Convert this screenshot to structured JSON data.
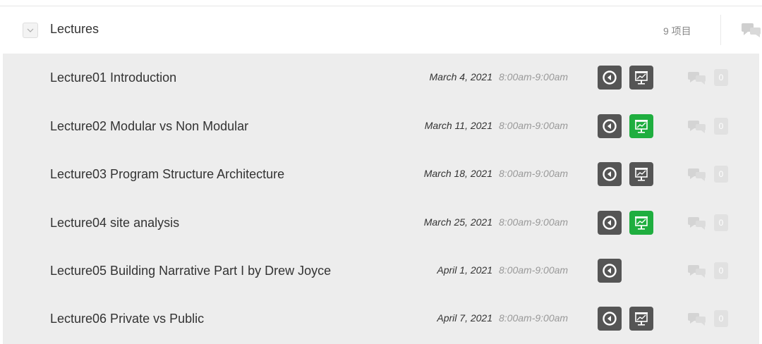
{
  "section": {
    "title": "Lectures",
    "item_count": "9 项目"
  },
  "lectures": [
    {
      "title": "Lecture01 Introduction",
      "date": "March 4, 2021",
      "time": "8:00am-9:00am",
      "has_slides": true,
      "slides_highlighted": false,
      "comment_count": "0"
    },
    {
      "title": "Lecture02 Modular vs Non Modular",
      "date": "March 11, 2021",
      "time": "8:00am-9:00am",
      "has_slides": true,
      "slides_highlighted": true,
      "comment_count": "0"
    },
    {
      "title": "Lecture03 Program Structure Architecture",
      "date": "March 18, 2021",
      "time": "8:00am-9:00am",
      "has_slides": true,
      "slides_highlighted": false,
      "comment_count": "0"
    },
    {
      "title": "Lecture04 site analysis",
      "date": "March 25, 2021",
      "time": "8:00am-9:00am",
      "has_slides": true,
      "slides_highlighted": true,
      "comment_count": "0"
    },
    {
      "title": "Lecture05 Building Narrative Part I by Drew Joyce",
      "date": "April 1, 2021",
      "time": "8:00am-9:00am",
      "has_slides": false,
      "slides_highlighted": false,
      "comment_count": "0"
    },
    {
      "title": "Lecture06 Private vs Public",
      "date": "April 7, 2021",
      "time": "8:00am-9:00am",
      "has_slides": true,
      "slides_highlighted": false,
      "comment_count": "0"
    }
  ],
  "icons": {
    "collapse": "chevron-down-icon",
    "comments": "comments-icon",
    "video": "play-back-circle-icon",
    "slides": "presentation-icon"
  },
  "colors": {
    "list_background": "#ededed",
    "button_dark": "#555555",
    "button_green": "#1fae3f",
    "comment_icon": "#d4d4d4"
  }
}
